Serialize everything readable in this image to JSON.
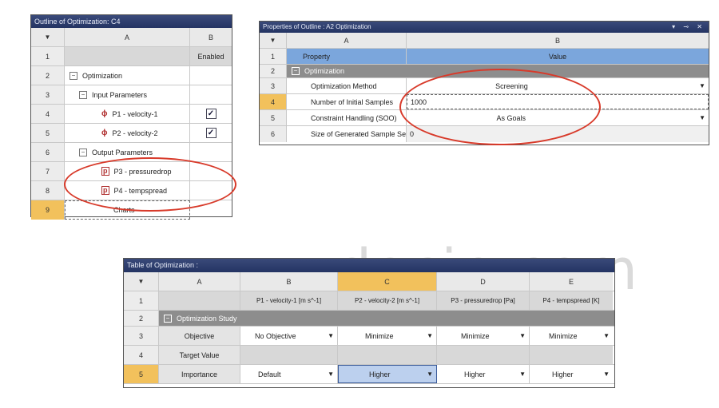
{
  "outline": {
    "title": "Outline of Optimization: C4",
    "col_a": "A",
    "col_b": "B",
    "enabled": "Enabled",
    "optimization": "Optimization",
    "input_params": "Input Parameters",
    "p1": "P1 - velocity-1",
    "p2": "P2 - velocity-2",
    "output_params": "Output Parameters",
    "p3": "P3 - pressuredrop",
    "p4": "P4 - tempspread",
    "charts": "Charts",
    "rows": [
      "1",
      "2",
      "3",
      "4",
      "5",
      "6",
      "7",
      "8",
      "9"
    ],
    "p1_checked": true,
    "p2_checked": true
  },
  "properties": {
    "title": "Properties of Outline : A2 Optimization",
    "controls": "▾ ⊸ ✕",
    "col_a": "A",
    "col_b": "B",
    "rows": [
      "1",
      "2",
      "3",
      "4",
      "5",
      "6"
    ],
    "property_label": "Property",
    "value_label": "Value",
    "section": "Optimization",
    "method_label": "Optimization Method",
    "method_value": "Screening",
    "samples_label": "Number of Initial Samples",
    "samples_value": "1000",
    "constraint_label": "Constraint Handling (SOO)",
    "constraint_value": "As Goals",
    "size_label": "Size of Generated Sample Set",
    "size_value": "0"
  },
  "table": {
    "title": "Table of Optimization :",
    "col_headers": [
      "A",
      "B",
      "C",
      "D",
      "E"
    ],
    "rows": [
      "1",
      "2",
      "3",
      "4",
      "5"
    ],
    "params": [
      "P1 - velocity-1 [m s^-1]",
      "P2 - velocity-2 [m s^-1]",
      "P3 - pressuredrop [Pa]",
      "P4 - tempspread [K]"
    ],
    "study": "Optimization Study",
    "objective_label": "Objective",
    "objectives": [
      "No Objective",
      "Minimize",
      "Minimize",
      "Minimize"
    ],
    "target_label": "Target Value",
    "importance_label": "Importance",
    "importance": [
      "Default",
      "Higher",
      "Higher",
      "Higher"
    ]
  },
  "watermark": "www.docin.com",
  "colors": {
    "titlebar": "#243463",
    "selected_row": "#f2c15c",
    "highlight": "#7ba6dc",
    "annotation": "#d83a2a"
  }
}
